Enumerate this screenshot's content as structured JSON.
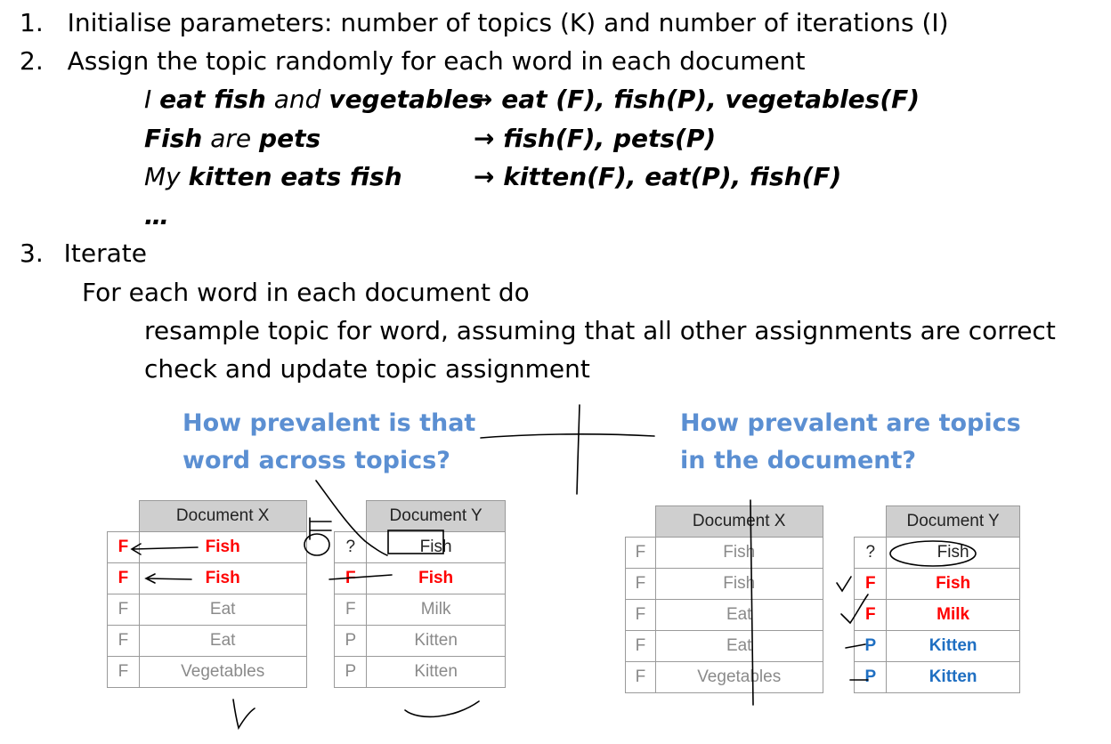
{
  "steps": [
    {
      "num": "1.",
      "text": "Initialise parameters: number of topics (K) and number of iterations (I)"
    },
    {
      "num": "2.",
      "text": "Assign the topic randomly for each word in each document"
    },
    {
      "num": "3.",
      "text": "Iterate"
    }
  ],
  "examples": [
    {
      "parts": [
        {
          "t": "I ",
          "b": false
        },
        {
          "t": "eat fish",
          "b": true
        },
        {
          "t": " and ",
          "b": false
        },
        {
          "t": "vegetables",
          "b": true
        }
      ],
      "result": "→ eat (F), fish(P), vegetables(F)"
    },
    {
      "parts": [
        {
          "t": "Fish",
          "b": true
        },
        {
          "t": " are ",
          "b": false
        },
        {
          "t": "pets",
          "b": true
        }
      ],
      "result": "→ fish(F), pets(P)"
    },
    {
      "parts": [
        {
          "t": "My ",
          "b": false
        },
        {
          "t": "kitten eats fish",
          "b": true
        }
      ],
      "result": "→ kitten(F), eat(P), fish(F)"
    }
  ],
  "ellipsis": "…",
  "iterate": {
    "line1": "For each word in each document do",
    "line2": "resample topic for word, assuming that all other assignments are correct",
    "line3": "check and update topic assignment"
  },
  "questions": {
    "left": "How prevalent is that word across topics?",
    "right": "How prevalent are topics in the document?"
  },
  "colors": {
    "question": "#5b8fd2",
    "topic_f": "#ff0000",
    "topic_p": "#1f6fc2"
  },
  "table_left": {
    "headers": {
      "doc_x": "Document X",
      "doc_y": "Document Y"
    },
    "rows": [
      {
        "lx": "F",
        "lx_style": "red",
        "wx": "Fish",
        "wx_style": "red",
        "ly": "?",
        "ly_style": "plain",
        "wy": "Fish",
        "wy_style": "plain"
      },
      {
        "lx": "F",
        "lx_style": "red",
        "wx": "Fish",
        "wx_style": "red",
        "ly": "F",
        "ly_style": "red",
        "wy": "Fish",
        "wy_style": "red"
      },
      {
        "lx": "F",
        "lx_style": "",
        "wx": "Eat",
        "wx_style": "",
        "ly": "F",
        "ly_style": "",
        "wy": "Milk",
        "wy_style": ""
      },
      {
        "lx": "F",
        "lx_style": "",
        "wx": "Eat",
        "wx_style": "",
        "ly": "P",
        "ly_style": "",
        "wy": "Kitten",
        "wy_style": ""
      },
      {
        "lx": "F",
        "lx_style": "",
        "wx": "Vegetables",
        "wx_style": "",
        "ly": "P",
        "ly_style": "",
        "wy": "Kitten",
        "wy_style": ""
      }
    ]
  },
  "table_right": {
    "headers": {
      "doc_x": "Document X",
      "doc_y": "Document Y"
    },
    "rows": [
      {
        "lx": "F",
        "lx_style": "",
        "wx": "Fish",
        "wx_style": "",
        "ly": "?",
        "ly_style": "plain",
        "wy": "Fish",
        "wy_style": "plain"
      },
      {
        "lx": "F",
        "lx_style": "",
        "wx": "Fish",
        "wx_style": "",
        "ly": "F",
        "ly_style": "red",
        "wy": "Fish",
        "wy_style": "red"
      },
      {
        "lx": "F",
        "lx_style": "",
        "wx": "Eat",
        "wx_style": "",
        "ly": "F",
        "ly_style": "red",
        "wy": "Milk",
        "wy_style": "red"
      },
      {
        "lx": "F",
        "lx_style": "",
        "wx": "Eat",
        "wx_style": "",
        "ly": "P",
        "ly_style": "blue",
        "wy": "Kitten",
        "wy_style": "blue"
      },
      {
        "lx": "F",
        "lx_style": "",
        "wx": "Vegetables",
        "wx_style": "",
        "ly": "P",
        "ly_style": "blue",
        "wy": "Kitten",
        "wy_style": "blue"
      }
    ]
  }
}
